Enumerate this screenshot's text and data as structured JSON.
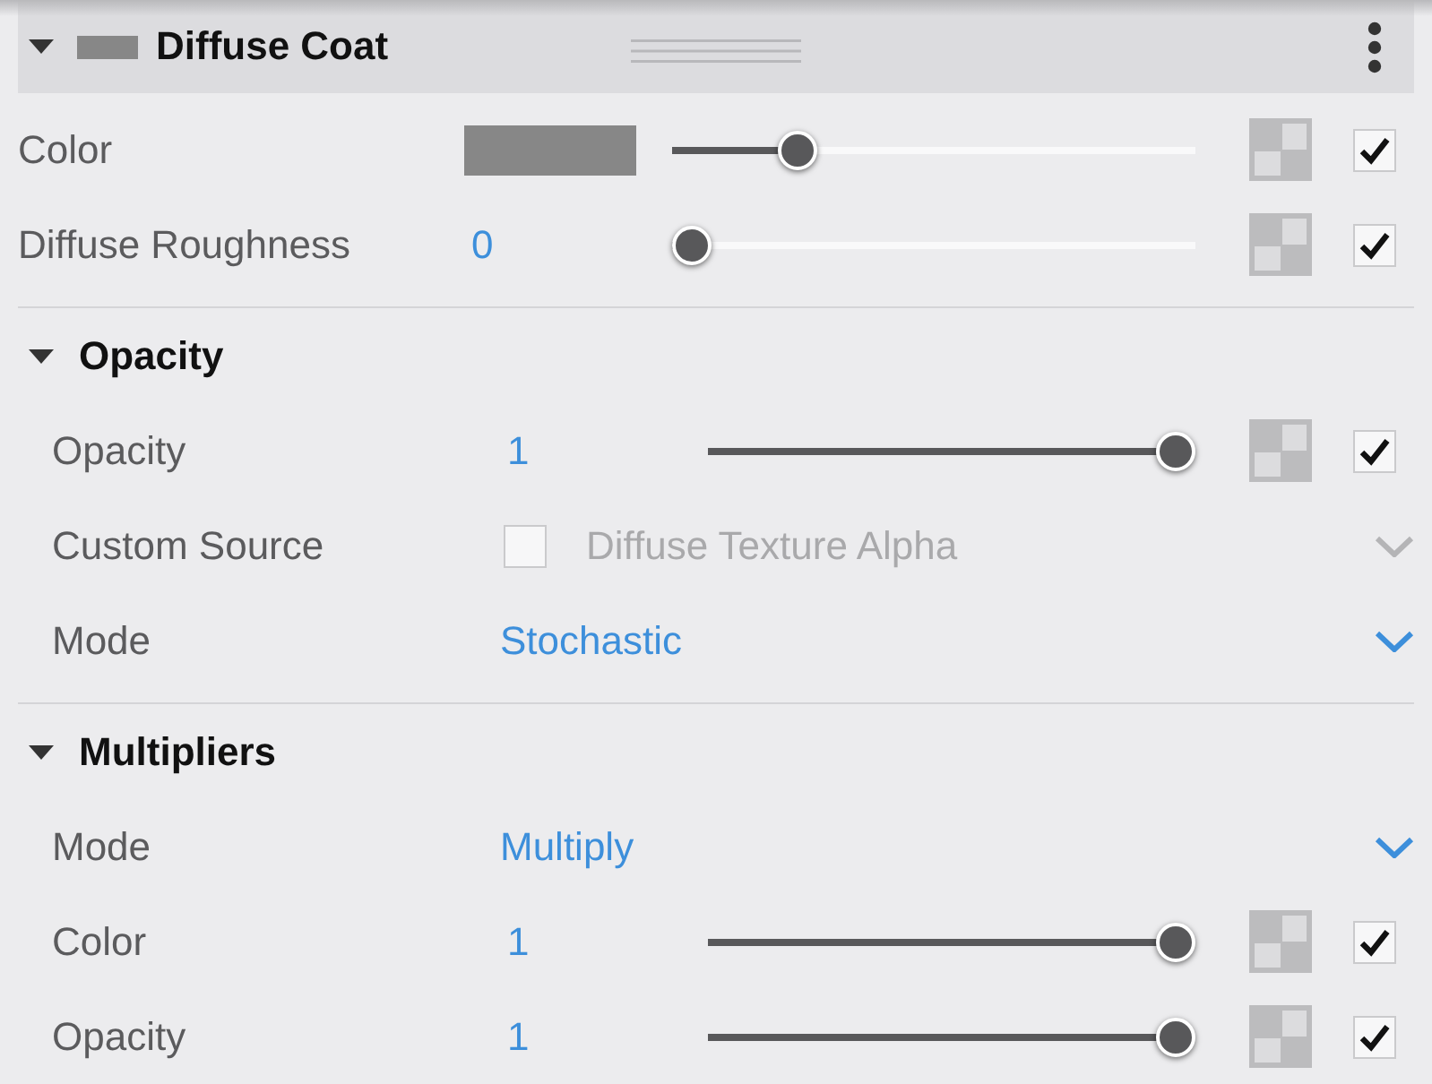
{
  "header": {
    "title": "Diffuse Coat",
    "expanded": true
  },
  "properties": [
    {
      "kind": "color",
      "label": "Color",
      "level": 0.22,
      "checked": true
    },
    {
      "kind": "slider",
      "label": "Diffuse Roughness",
      "value": "0",
      "level": 0,
      "checked": true
    }
  ],
  "sections": [
    {
      "title": "Opacity",
      "expanded": true,
      "properties": [
        {
          "kind": "slider",
          "label": "Opacity",
          "value": "1",
          "level": 1,
          "checked": true
        },
        {
          "kind": "checkbox-dropdown",
          "label": "Custom Source",
          "checked": false,
          "value": "Diffuse Texture Alpha",
          "disabled": true
        },
        {
          "kind": "dropdown",
          "label": "Mode",
          "value": "Stochastic",
          "disabled": false
        }
      ]
    },
    {
      "title": "Multipliers",
      "expanded": true,
      "properties": [
        {
          "kind": "dropdown",
          "label": "Mode",
          "value": "Multiply",
          "disabled": false
        },
        {
          "kind": "slider",
          "label": "Color",
          "value": "1",
          "level": 1,
          "checked": true
        },
        {
          "kind": "slider",
          "label": "Opacity",
          "value": "1",
          "level": 1,
          "checked": true
        }
      ]
    }
  ]
}
